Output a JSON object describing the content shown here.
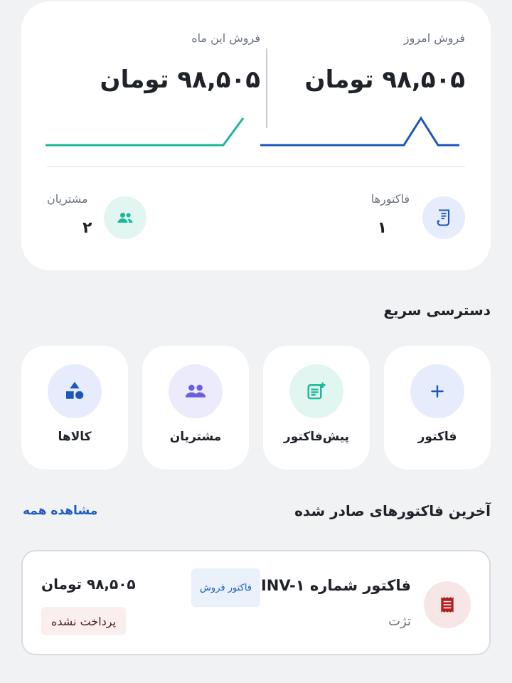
{
  "stats": {
    "today": {
      "label": "فروش امروز",
      "value": "۹۸,۵۰۵ تومان",
      "color": "#1c56b8"
    },
    "month": {
      "label": "فروش این ماه",
      "value": "۹۸,۵۰۵ تومان",
      "color": "#1bb89a"
    },
    "invoices": {
      "label": "فاکتورها",
      "count": "۱",
      "icon": "receipt-icon"
    },
    "customers": {
      "label": "مشتریان",
      "count": "۲",
      "icon": "group-icon"
    }
  },
  "quick_access": {
    "title": "دسترسی سریع",
    "items": [
      {
        "label": "فاکتور",
        "icon": "plus-icon",
        "bg": "#e6ecfb",
        "fg": "#1c56b8"
      },
      {
        "label": "پیش‌فاکتور",
        "icon": "note-add-icon",
        "bg": "#e2f6f1",
        "fg": "#1bb89a"
      },
      {
        "label": "مشتریان",
        "icon": "group-icon",
        "bg": "#ecebfb",
        "fg": "#6a5fe0"
      },
      {
        "label": "کالاها",
        "icon": "shapes-icon",
        "bg": "#e6ecfb",
        "fg": "#1c56b8"
      }
    ]
  },
  "recent": {
    "title": "آخرین فاکتورهای صادر شده",
    "view_all": "مشاهده همه",
    "invoices": [
      {
        "title": "فاکتور شماره INV-۱",
        "type": "فاکتور فروش",
        "customer": "تژت",
        "amount": "۹۸,۵۰۵ تومان",
        "status": "پرداخت نشده"
      }
    ]
  }
}
